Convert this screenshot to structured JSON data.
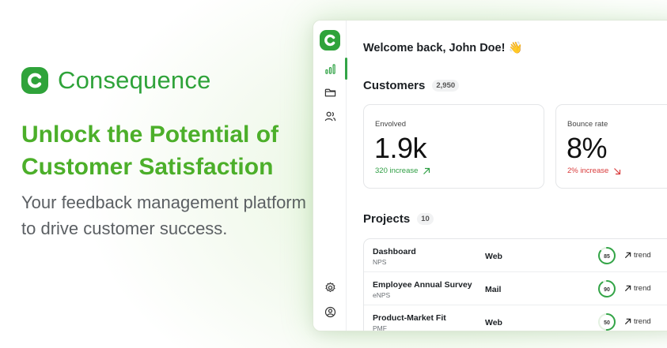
{
  "brand": {
    "name": "Consequence",
    "color": "#2fa33a"
  },
  "hero": {
    "headline": "Unlock the Potential of Customer Satisfaction",
    "subline": "Your feedback management platform to drive customer success."
  },
  "app": {
    "welcome": "Welcome back, John Doe!",
    "welcome_emoji": "👋",
    "sidebar": {
      "items": [
        {
          "icon": "bar-chart-icon",
          "active": true
        },
        {
          "icon": "folder-icon",
          "active": false
        },
        {
          "icon": "users-icon",
          "active": false
        },
        {
          "icon": "settings-icon",
          "active": false
        },
        {
          "icon": "user-circle-icon",
          "active": false
        }
      ]
    },
    "customers": {
      "title": "Customers",
      "count": "2,950",
      "cards": [
        {
          "label": "Envolved",
          "value": "1.9k",
          "delta": "320 increase",
          "direction": "up"
        },
        {
          "label": "Bounce rate",
          "value": "8%",
          "delta": "2% increase",
          "direction": "down"
        }
      ]
    },
    "projects": {
      "title": "Projects",
      "count": "10",
      "rows": [
        {
          "name": "Dashboard",
          "type": "NPS",
          "channel": "Web",
          "score": "85",
          "score_pct": 85,
          "trend": "trend"
        },
        {
          "name": "Employee Annual Survey",
          "type": "eNPS",
          "channel": "Mail",
          "score": "90",
          "score_pct": 90,
          "trend": "trend"
        },
        {
          "name": "Product-Market Fit",
          "type": "PMF",
          "channel": "Web",
          "score": "50",
          "score_pct": 50,
          "trend": "trend"
        }
      ]
    }
  },
  "colors": {
    "accent": "#33a447",
    "positive": "#2e9e43",
    "negative": "#d93b3b",
    "headline": "#4caf2a"
  }
}
